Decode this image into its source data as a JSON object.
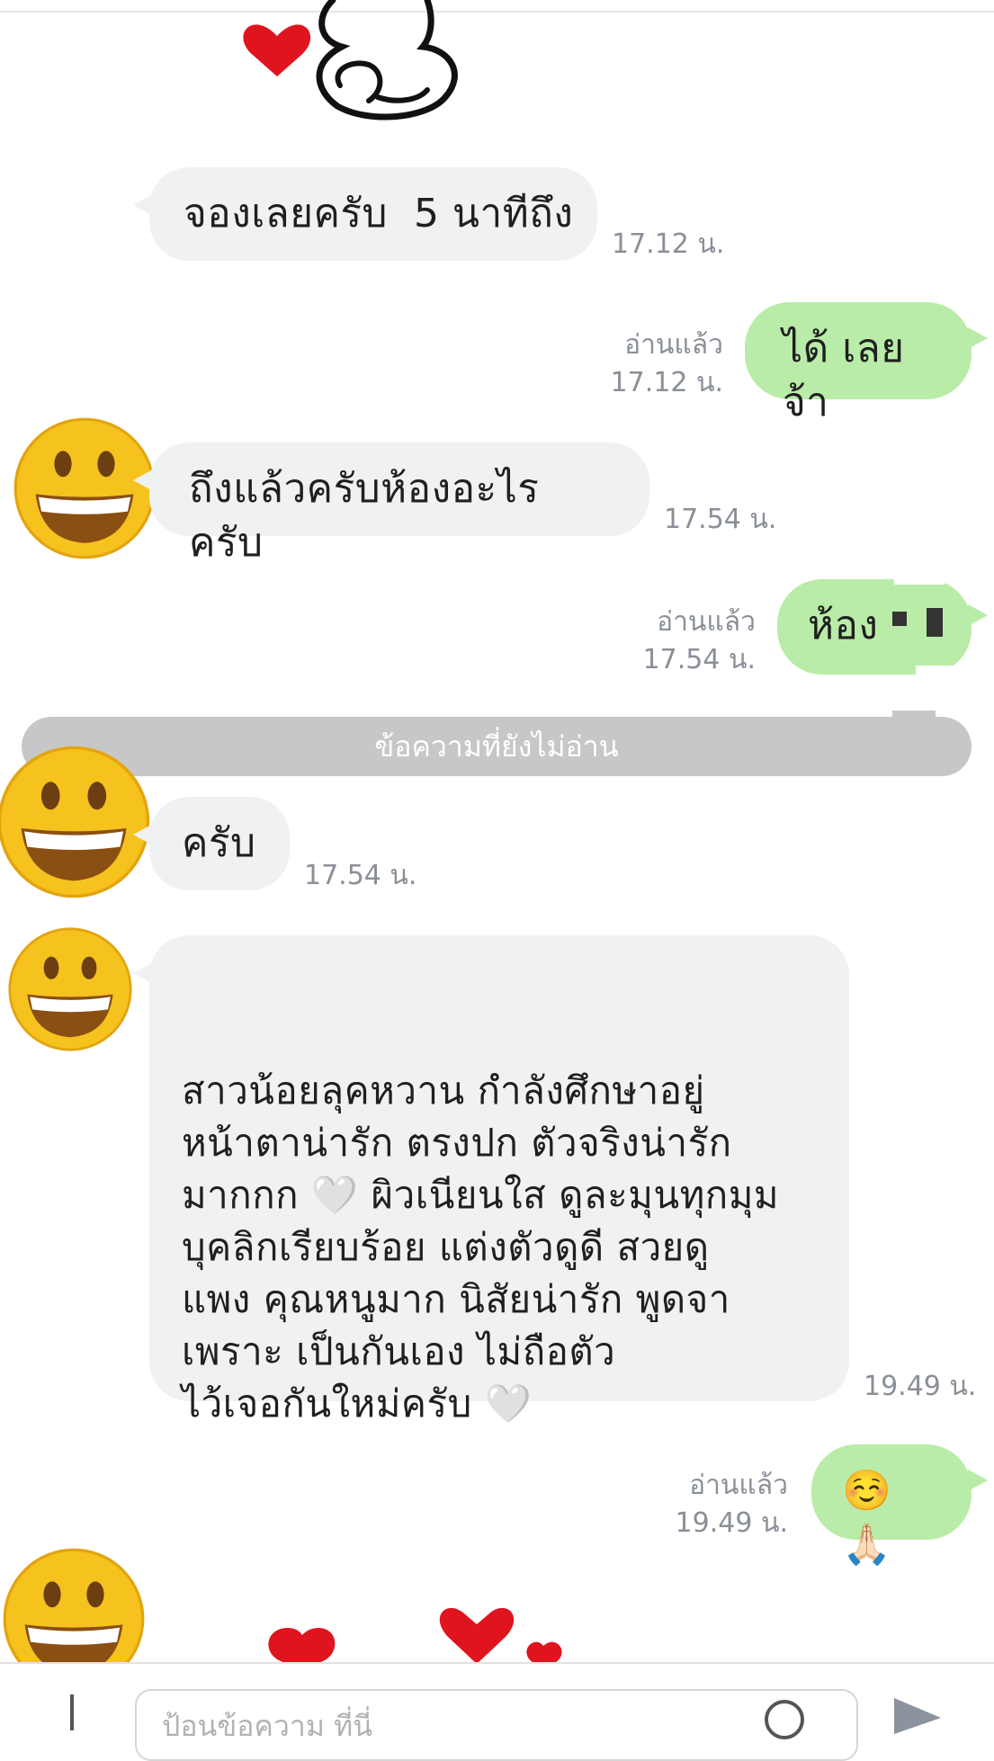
{
  "messages": [
    {
      "id": "m1",
      "text": "จองเลยครับ  5 นาทีถึง",
      "time": "17.12 น."
    },
    {
      "id": "m2",
      "text": "ได้ เลยจ้า",
      "read": "อ่านแล้ว",
      "time": "17.12 น."
    },
    {
      "id": "m3",
      "text": "ถึงแล้วครับห้องอะไรครับ",
      "time": "17.54 น."
    },
    {
      "id": "m4",
      "text": "ห้อง",
      "read": "อ่านแล้ว",
      "time": "17.54 น."
    },
    {
      "id": "m5",
      "text": "ครับ",
      "time": "17.54 น."
    },
    {
      "id": "m6",
      "text": "สาวน้อยลุคหวาน กำลังศึกษาอยู่\nหน้าตาน่ารัก ตรงปก ตัวจริงน่ารัก\nมากกก 🤍 ผิวเนียนใส ดูละมุนทุกมุม\nบุคลิกเรียบร้อย แต่งตัวดูดี สวยดู\nแพง คุณหนูมาก นิสัยน่ารัก พูดจา\nเพราะ เป็นกันเอง ไม่ถือตัว\nไว้เจอกันใหม่ครับ 🤍",
      "time": "19.49 น."
    },
    {
      "id": "m7",
      "text": "☺️🙏🏻",
      "read": "อ่านแล้ว",
      "time": "19.49 น."
    }
  ],
  "divider": {
    "label": "ข้อความที่ยังไม่อ่าน"
  },
  "composer": {
    "placeholder": "ป้อนข้อความ ที่นี่"
  },
  "icons": {
    "avatar": "grinning-face-emoji-icon",
    "sticker_top": "bear-heart-sticker-icon",
    "sticker_bottom": "hearts-sticker-icon",
    "plus": "plus-icon",
    "search": "search-icon",
    "send": "send-icon"
  },
  "colors": {
    "incoming_bubble": "#f0f1f3",
    "outgoing_bubble": "#b9eca8",
    "divider": "#c7c7c7",
    "meta_text": "#8a8f98",
    "heart": "#e0141e"
  }
}
